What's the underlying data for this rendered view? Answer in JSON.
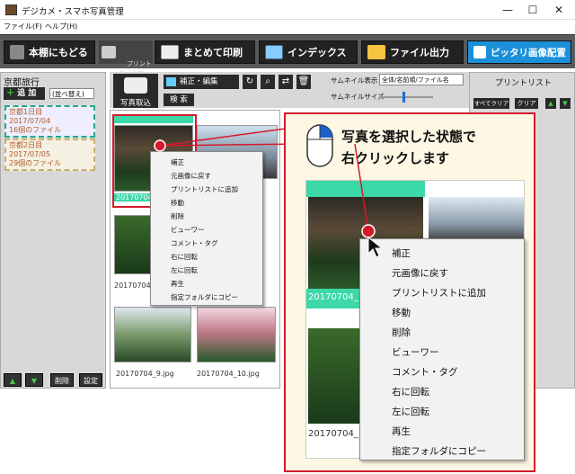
{
  "window": {
    "title": "デジカメ・スマホ写真管理",
    "min": "—",
    "max": "☐",
    "close": "✕"
  },
  "menu": [
    "ファイル(F)",
    "ヘルプ(H)"
  ],
  "toolbar": {
    "back": "本棚にもどる",
    "print_small": "プリント\nメニュー",
    "print_all": "まとめて印刷",
    "index": "インデックス",
    "file_out": "ファイル出力",
    "fit": "ピッタリ画像配置"
  },
  "left": {
    "album": "京都旅行",
    "add": "追 加",
    "sort": "(並べ替え)",
    "days": [
      {
        "name": "京都1日目",
        "date": "2017/07/04",
        "count": "16個のファイル"
      },
      {
        "name": "京都2日目",
        "date": "2017/07/05",
        "count": "29個のファイル"
      }
    ],
    "delete": "削除",
    "settings": "設定"
  },
  "controls": {
    "import": "写真取込",
    "edit": "補正・編集",
    "search": "検 索",
    "thumb_label": "サムネイル表示",
    "thumb_value": "全体/名前順/ファイル名",
    "thumb_size": "サムネイルサイズ"
  },
  "printlist": {
    "title": "プリントリスト",
    "clear_all": "すべてクリア",
    "clear": "クリア"
  },
  "thumbs": [
    "20170704_",
    "20170704_",
    "20170704_",
    "20170704_9.jpg",
    "20170704_10.jpg"
  ],
  "context_menu": [
    "補正",
    "元画像に戻す",
    "プリントリストに追加",
    "移動",
    "削除",
    "ビューワー",
    "コメント・タグ",
    "右に回転",
    "左に回転",
    "再生",
    "指定フォルダにコピー"
  ],
  "callout": {
    "line1": "写真を選択した状態で",
    "line2": "右クリックします",
    "zoom_caption_top": "20170704_",
    "zoom_caption_bottom": "20170704_!"
  },
  "colors": {
    "accent_red": "#d41a2a",
    "select_green": "#3cd8a8",
    "toolbar_dark": "#222222"
  }
}
